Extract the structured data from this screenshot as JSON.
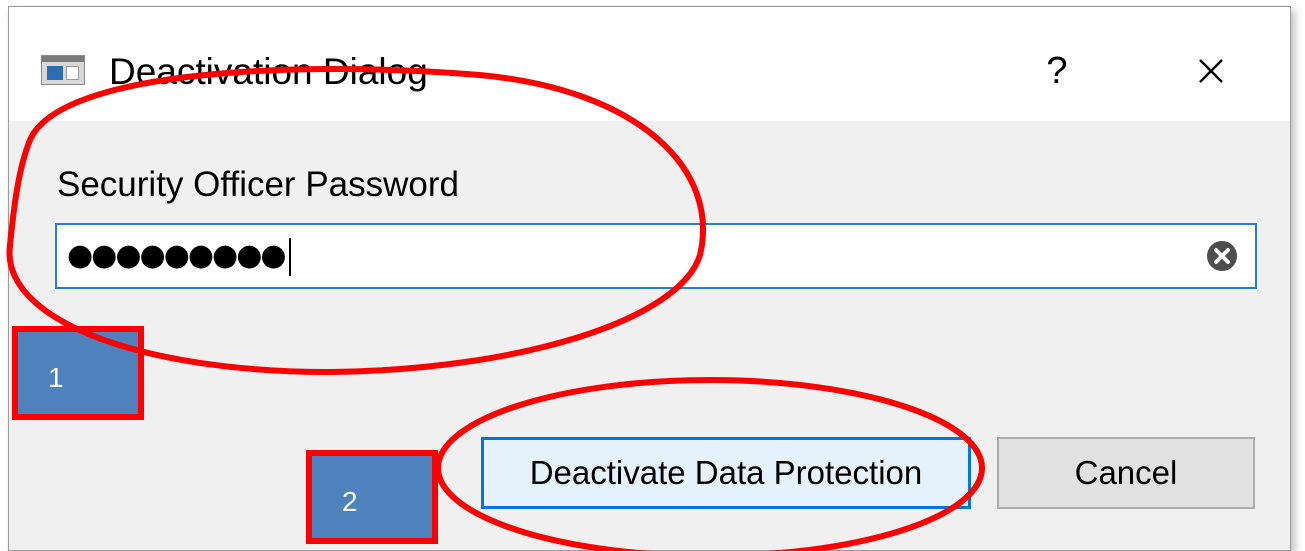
{
  "window": {
    "title": "Deactivation Dialog",
    "help_label": "?",
    "icon": "app-window-icon",
    "close_icon": "close-icon"
  },
  "form": {
    "password_label": "Security Officer Password",
    "password_value": "●●●●●●●●●",
    "clear_icon": "clear-input-icon"
  },
  "buttons": {
    "primary_label": "Deactivate Data Protection",
    "cancel_label": "Cancel"
  },
  "annotations": {
    "step_1": "1",
    "step_2": "2",
    "highlight_color": "#ff0000",
    "badge_color": "#4f81bd"
  },
  "colors": {
    "focus_border": "#0078d7",
    "dialog_bg": "#f0f0f0"
  }
}
